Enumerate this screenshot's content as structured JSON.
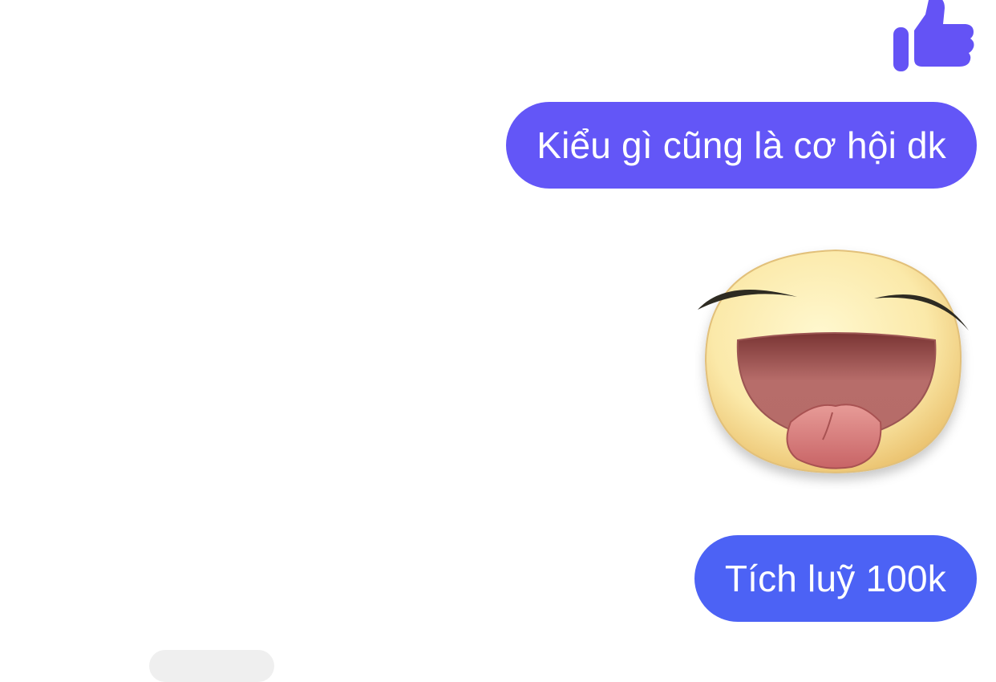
{
  "colors": {
    "bubble_first": "#6356f7",
    "bubble_last": "#4c62f5",
    "like_icon": "#6453f5",
    "background": "#ffffff"
  },
  "icons": {
    "like": "thumbs-up-icon",
    "sticker": "laughing-tongue-out-sticker"
  },
  "messages": [
    {
      "type": "like"
    },
    {
      "type": "text",
      "text": "Kiểu gì cũng là cơ hội dk"
    },
    {
      "type": "sticker"
    },
    {
      "type": "text",
      "text": "Tích luỹ 100k"
    }
  ]
}
